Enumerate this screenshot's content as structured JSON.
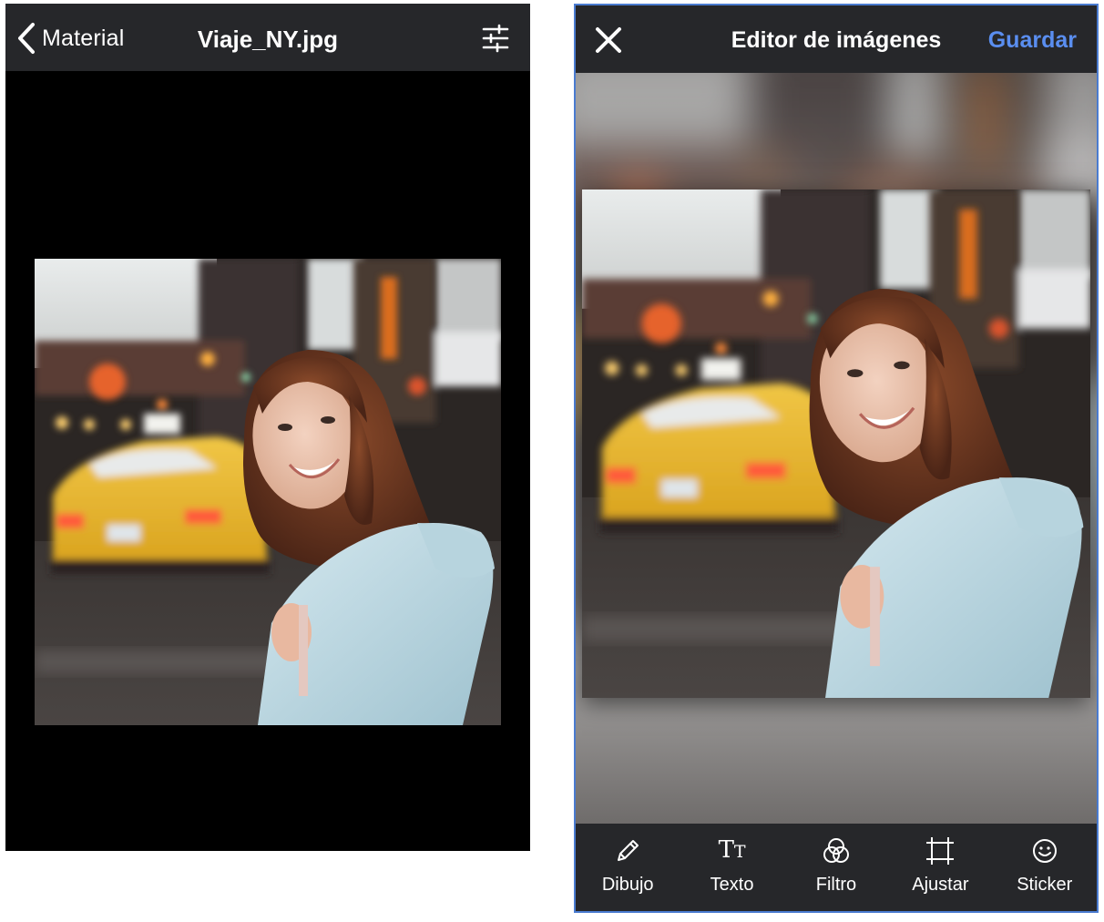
{
  "viewer": {
    "back_label": "Material",
    "title": "Viaje_NY.jpg",
    "back_icon": "chevron-left-icon",
    "adjust_icon": "sliders-icon",
    "photo_subject": "photo"
  },
  "editor": {
    "title": "Editor de imágenes",
    "save_label": "Guardar",
    "close_icon": "close-icon",
    "accent_color": "#5a8ef0",
    "tools": [
      {
        "label": "Dibujo",
        "icon": "pencil-icon"
      },
      {
        "label": "Texto",
        "icon": "text-icon"
      },
      {
        "label": "Filtro",
        "icon": "filter-icon"
      },
      {
        "label": "Ajustar",
        "icon": "crop-icon"
      },
      {
        "label": "Sticker",
        "icon": "smiley-icon"
      }
    ]
  }
}
